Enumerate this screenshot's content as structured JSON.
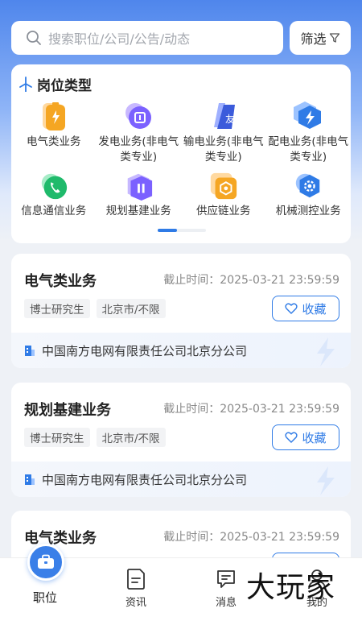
{
  "search": {
    "placeholder": "搜索职位/公司/公告/动态"
  },
  "filter": {
    "label": "筛选"
  },
  "categories": {
    "title": "岗位类型",
    "items": [
      {
        "label": "电气类业务",
        "icon": "battery-icon",
        "color": "#f5a623"
      },
      {
        "label": "发电业务(非电气类专业)",
        "icon": "power-plant-icon",
        "color": "#7b61ff"
      },
      {
        "label": "输电业务(非电气类专业)",
        "icon": "transmission-icon",
        "color": "#3b5bdb"
      },
      {
        "label": "配电业务(非电气类专业)",
        "icon": "lightning-icon",
        "color": "#2f7be6"
      },
      {
        "label": "信息通信业务",
        "icon": "phone-icon",
        "color": "#1fba6b"
      },
      {
        "label": "规划基建业务",
        "icon": "building-icon",
        "color": "#7b61ff"
      },
      {
        "label": "供应链业务",
        "icon": "supply-icon",
        "color": "#f5a623"
      },
      {
        "label": "机械测控业务",
        "icon": "gear-icon",
        "color": "#2f7be6"
      }
    ]
  },
  "jobs": [
    {
      "title": "电气类业务",
      "deadline": "截止时间：2025-03-21 23:59:59",
      "tags": [
        "博士研究生",
        "北京市/不限"
      ],
      "fav_label": "收藏",
      "company": "中国南方电网有限责任公司北京分公司"
    },
    {
      "title": "规划基建业务",
      "deadline": "截止时间：2025-03-21 23:59:59",
      "tags": [
        "博士研究生",
        "北京市/不限"
      ],
      "fav_label": "收藏",
      "company": "中国南方电网有限责任公司北京分公司"
    },
    {
      "title": "电气类业务",
      "deadline": "截止时间：2025-03-21 23:59:59"
    }
  ],
  "tabbar": [
    {
      "label": "职位",
      "icon": "briefcase-icon",
      "active": true
    },
    {
      "label": "资讯",
      "icon": "news-icon",
      "active": false
    },
    {
      "label": "消息",
      "icon": "message-icon",
      "active": false
    },
    {
      "label": "我的",
      "icon": "user-icon",
      "active": false
    }
  ],
  "watermark": "大玩家",
  "colors": {
    "accent": "#2f7be6",
    "hero": "#4f86ec"
  }
}
